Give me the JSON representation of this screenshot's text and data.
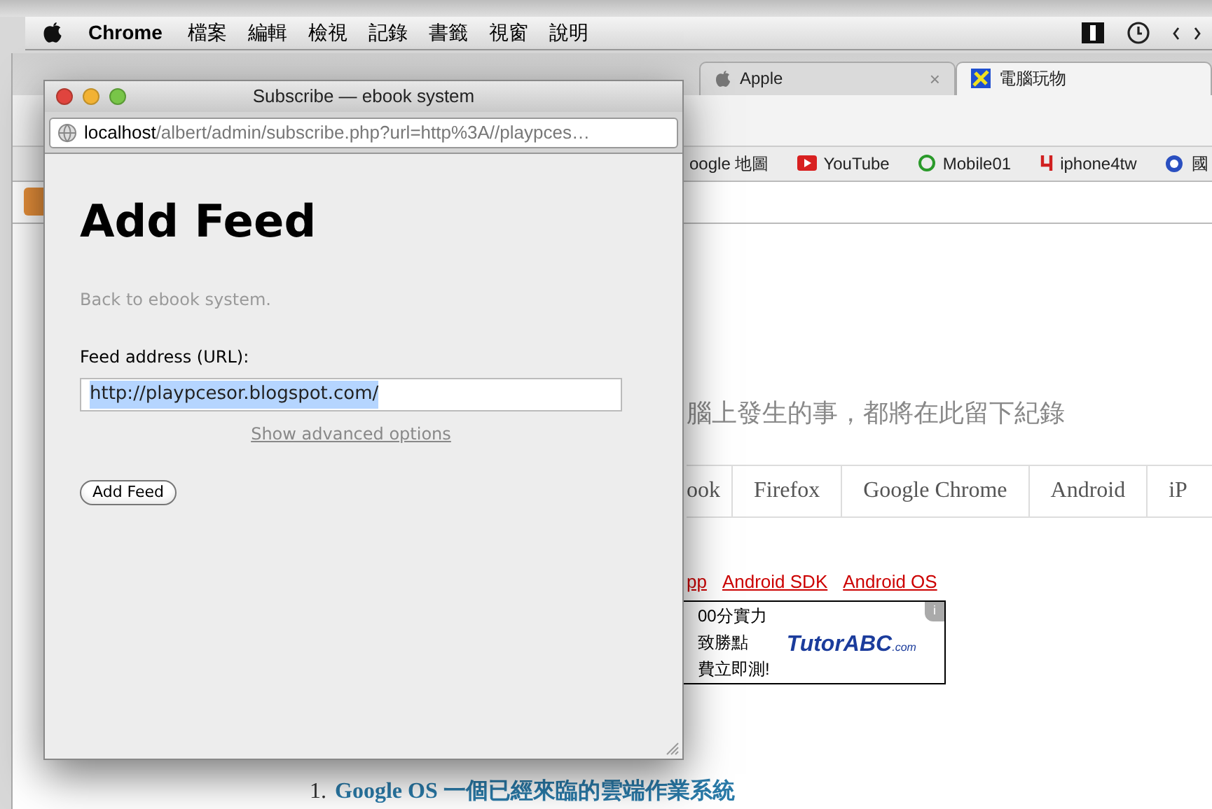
{
  "menu_bar": {
    "app": "Chrome",
    "items": [
      "檔案",
      "編輯",
      "檢視",
      "記錄",
      "書籤",
      "視窗",
      "說明"
    ]
  },
  "browser": {
    "tabs": [
      {
        "label": "Apple",
        "selected": false,
        "kind": "apple",
        "close": "×"
      },
      {
        "label": "電腦玩物",
        "selected": true,
        "kind": "site"
      }
    ],
    "bookmarks": [
      {
        "label": "oogle 地圖",
        "kind": "plain"
      },
      {
        "label": "YouTube",
        "kind": "youtube"
      },
      {
        "label": "Mobile01",
        "kind": "mobile01"
      },
      {
        "label": "iphone4tw",
        "kind": "iphone4tw"
      },
      {
        "label": "國",
        "kind": "globe"
      }
    ],
    "page": {
      "tagline": "腦上發生的事，都將在此留下紀錄",
      "nav": [
        "ook",
        "Firefox",
        "Google Chrome",
        "Android",
        "iP"
      ],
      "tag_links": [
        "pp",
        "Android SDK",
        "Android OS"
      ],
      "ad": {
        "lines": [
          "00分實力",
          "致勝點",
          "費立即測!"
        ],
        "brand": "TutorABC",
        "brand_suffix": ".com",
        "info": "i"
      },
      "posts": [
        {
          "number": "1.",
          "title": "Google OS 一個已經來臨的雲端作業系統"
        }
      ]
    }
  },
  "popup": {
    "title": "Subscribe — ebook system",
    "url_host": "localhost",
    "url_path": "/albert/admin/subscribe.php?url=http%3A//playpces…",
    "heading": "Add Feed",
    "back_link": "Back to ebook system.",
    "field_label": "Feed address (URL):",
    "field_value": "http://playpcesor.blogspot.com/",
    "advanced_link": "Show advanced options",
    "submit": "Add Feed"
  }
}
